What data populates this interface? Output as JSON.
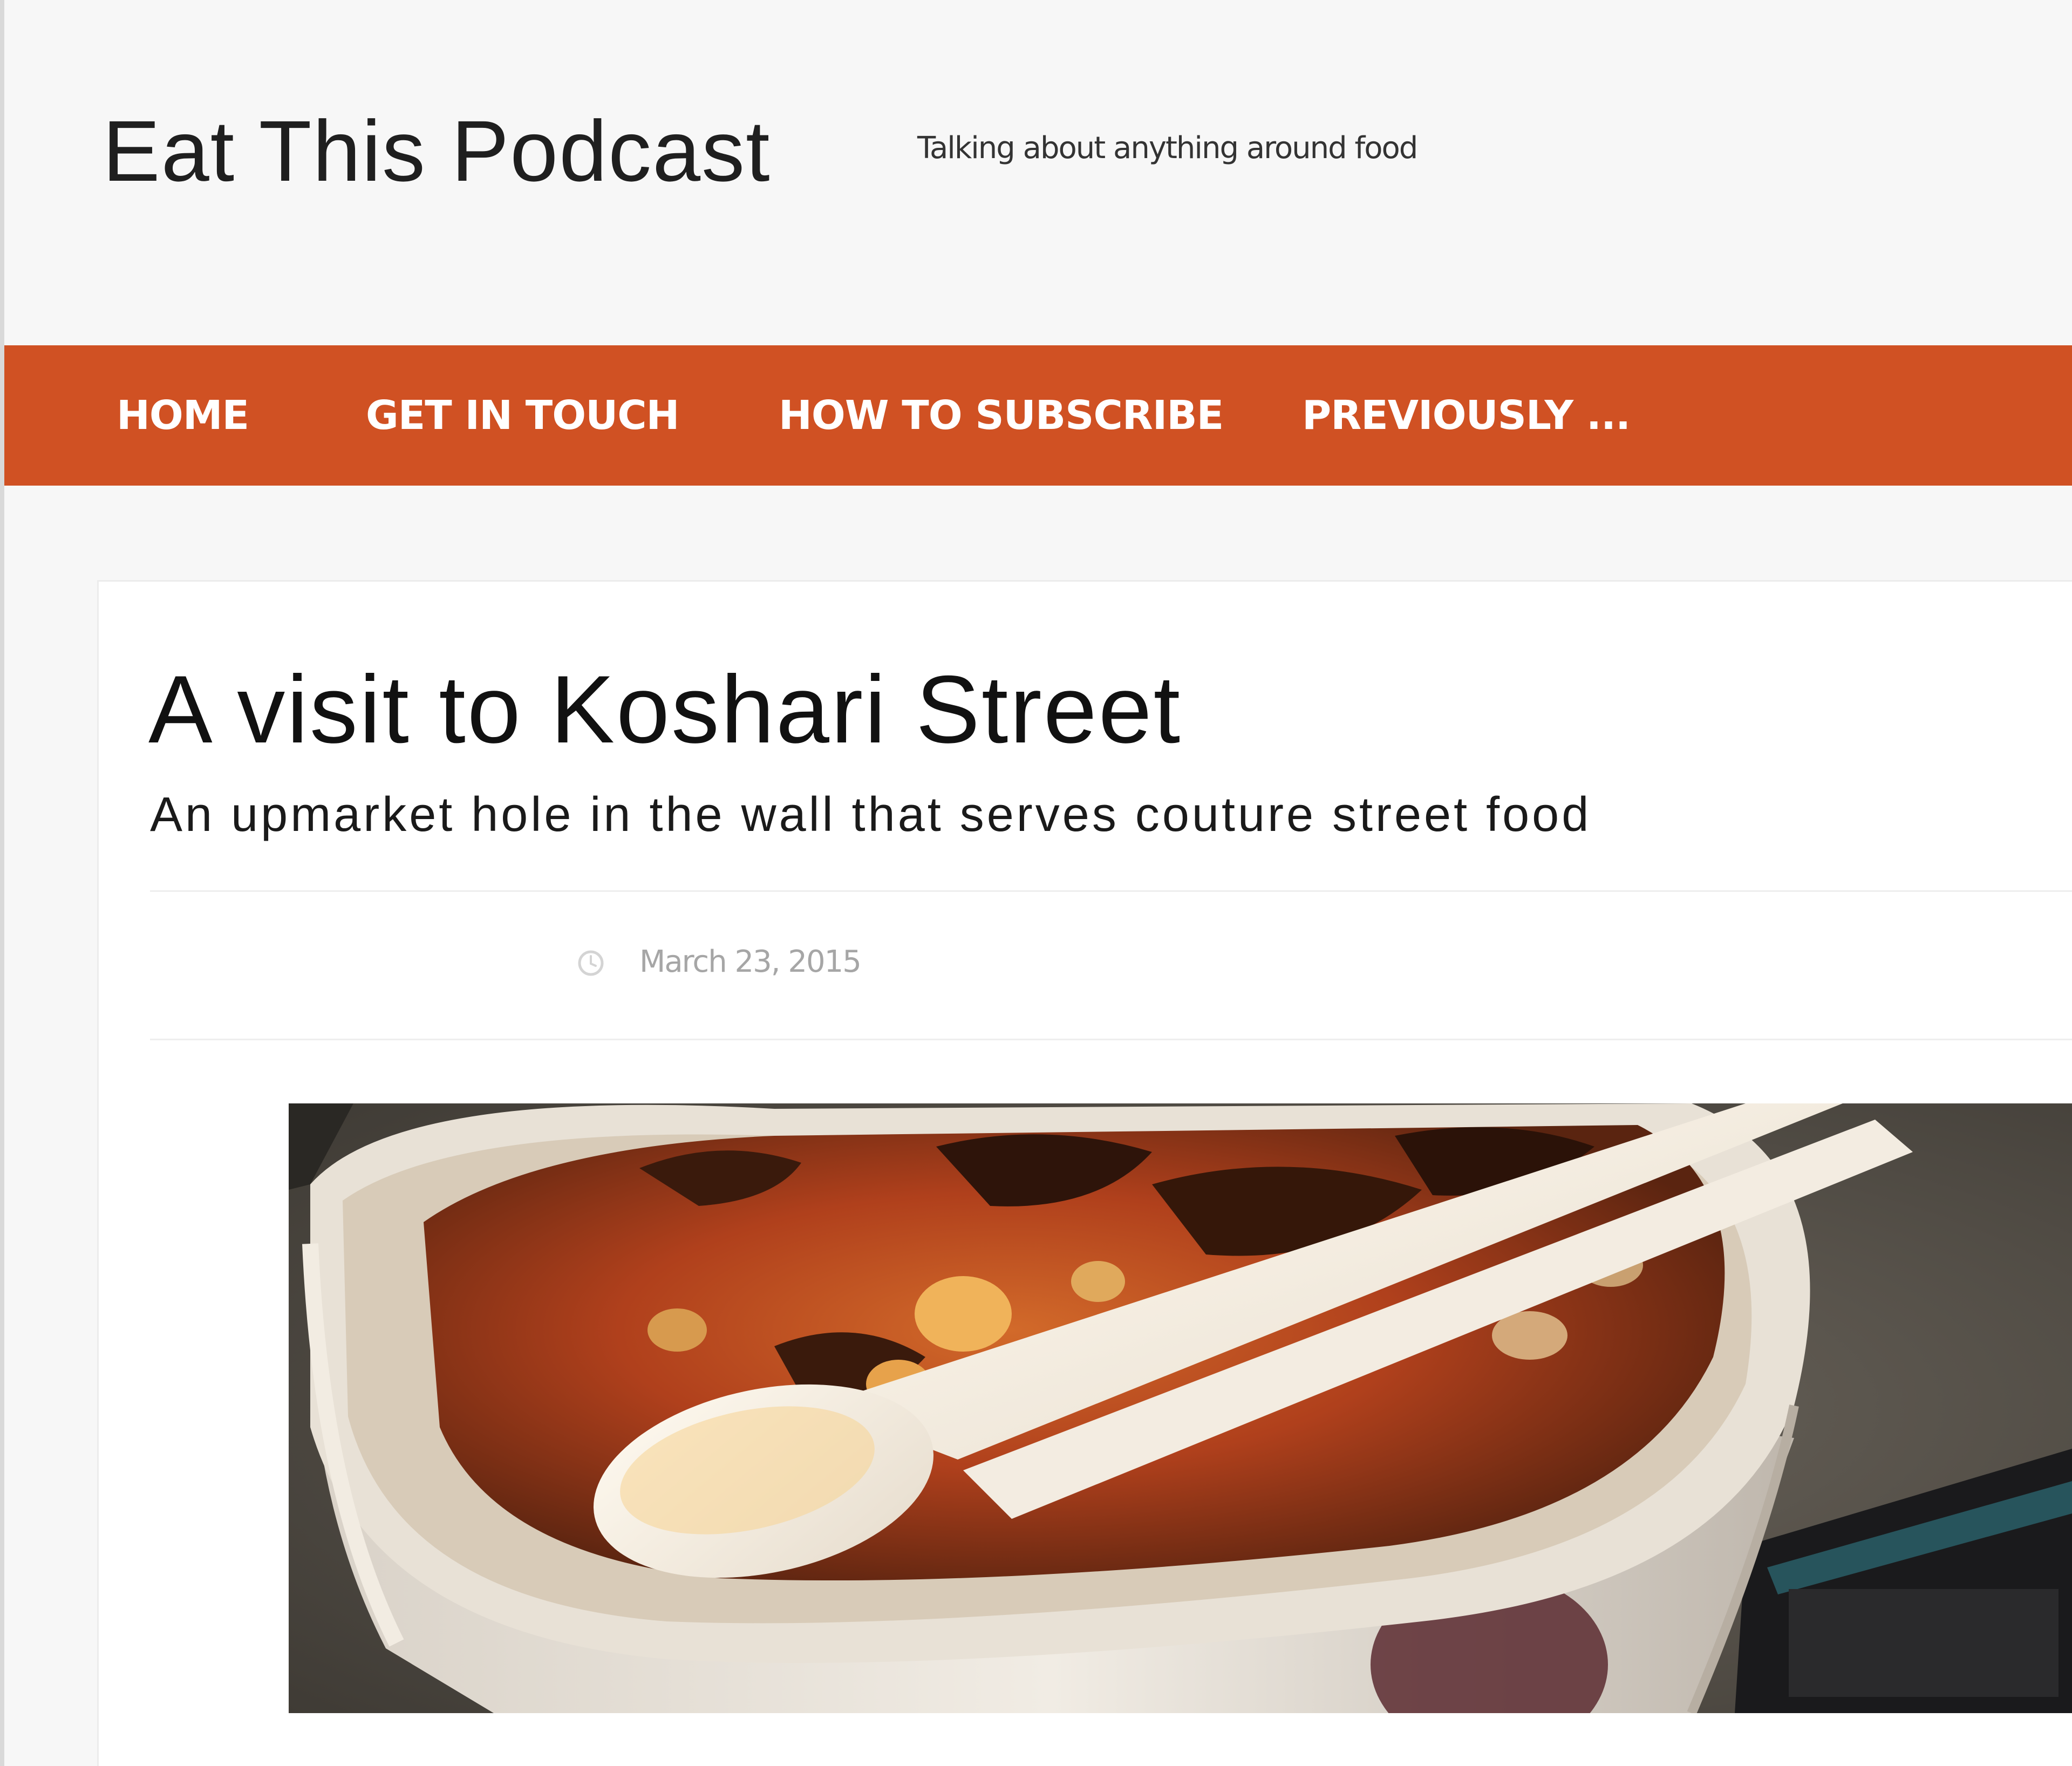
{
  "site": {
    "title": "Eat This Podcast",
    "tagline": "Talking about anything around food"
  },
  "nav": {
    "items": [
      {
        "label": "HOME"
      },
      {
        "label": "GET IN TOUCH"
      },
      {
        "label": "HOW TO SUBSCRIBE"
      },
      {
        "label": "PREVIOUSLY ..."
      }
    ],
    "background_color": "#d05123"
  },
  "post": {
    "title": "A visit to Koshari Street",
    "subtitle": "An upmarket hole in the wall that serves couture street food",
    "date": "March 23, 2015",
    "date_icon": "clock-icon",
    "image_subject": "paper cup of koshari with a plastic spoon"
  }
}
